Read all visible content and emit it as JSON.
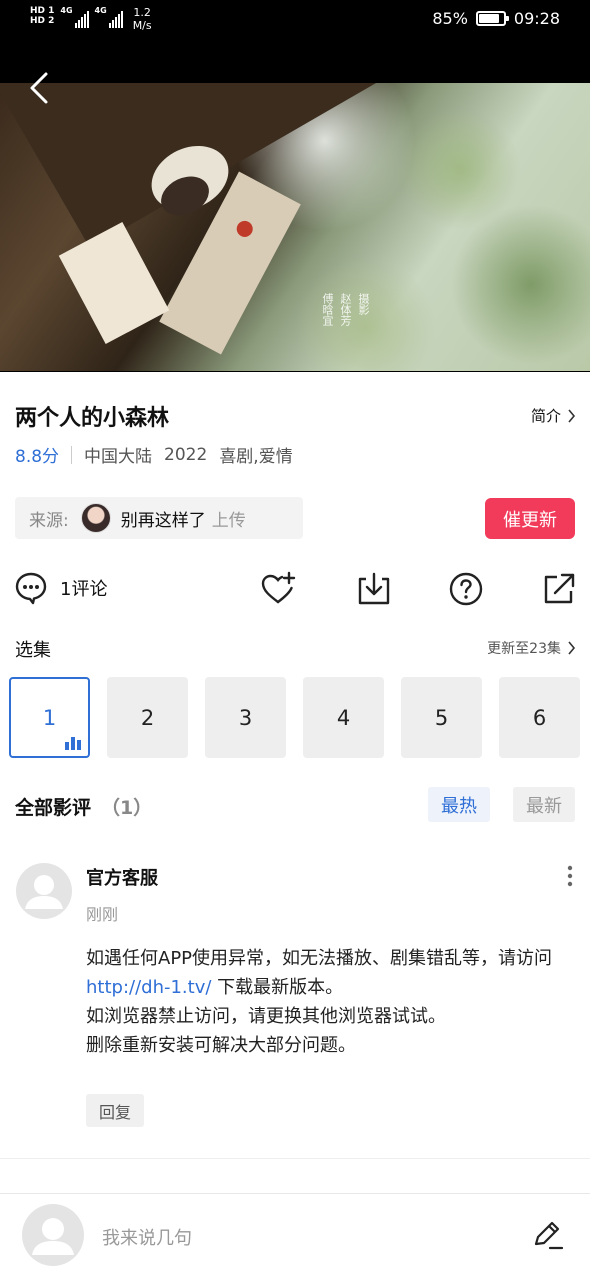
{
  "status_bar": {
    "sim1": "HD 1",
    "sim2": "HD 2",
    "net1": "4G",
    "net2": "4G",
    "speed_value": "1.2",
    "speed_unit": "M/s",
    "battery_percent": "85%",
    "battery_level": 0.85,
    "time": "09:28"
  },
  "video": {
    "credit_lines": [
      "摄",
      "影",
      "赵",
      "体",
      "芳",
      "傅",
      "晗",
      "宜"
    ]
  },
  "show": {
    "title": "两个人的小森林",
    "intro_label": "简介",
    "score": "8.8分",
    "region": "中国大陆",
    "year": "2022",
    "genres": "喜剧,爱情"
  },
  "source": {
    "label": "来源:",
    "uploader": "别再这样了",
    "upload_label": "上传",
    "urge_button": "催更新"
  },
  "actions": {
    "comment_count": "1评论"
  },
  "episodes": {
    "title": "选集",
    "update_label": "更新至23集",
    "items": [
      "1",
      "2",
      "3",
      "4",
      "5",
      "6"
    ],
    "active_index": 0
  },
  "reviews": {
    "title": "全部影评",
    "count": "（1）",
    "sort_hot": "最热",
    "sort_new": "最新",
    "items": [
      {
        "name": "官方客服",
        "time": "刚刚",
        "line1": "如遇任何APP使用异常，如无法播放、剧集错乱等，请访问",
        "link": "http://dh-1.tv/",
        "line2": " 下载最新版本。",
        "line3": "如浏览器禁止访问，请更换其他浏览器试试。",
        "line4": "删除重新安装可解决大部分问题。",
        "reply": "回复"
      }
    ]
  },
  "bottom_bar": {
    "input_placeholder": "我来说几句"
  }
}
